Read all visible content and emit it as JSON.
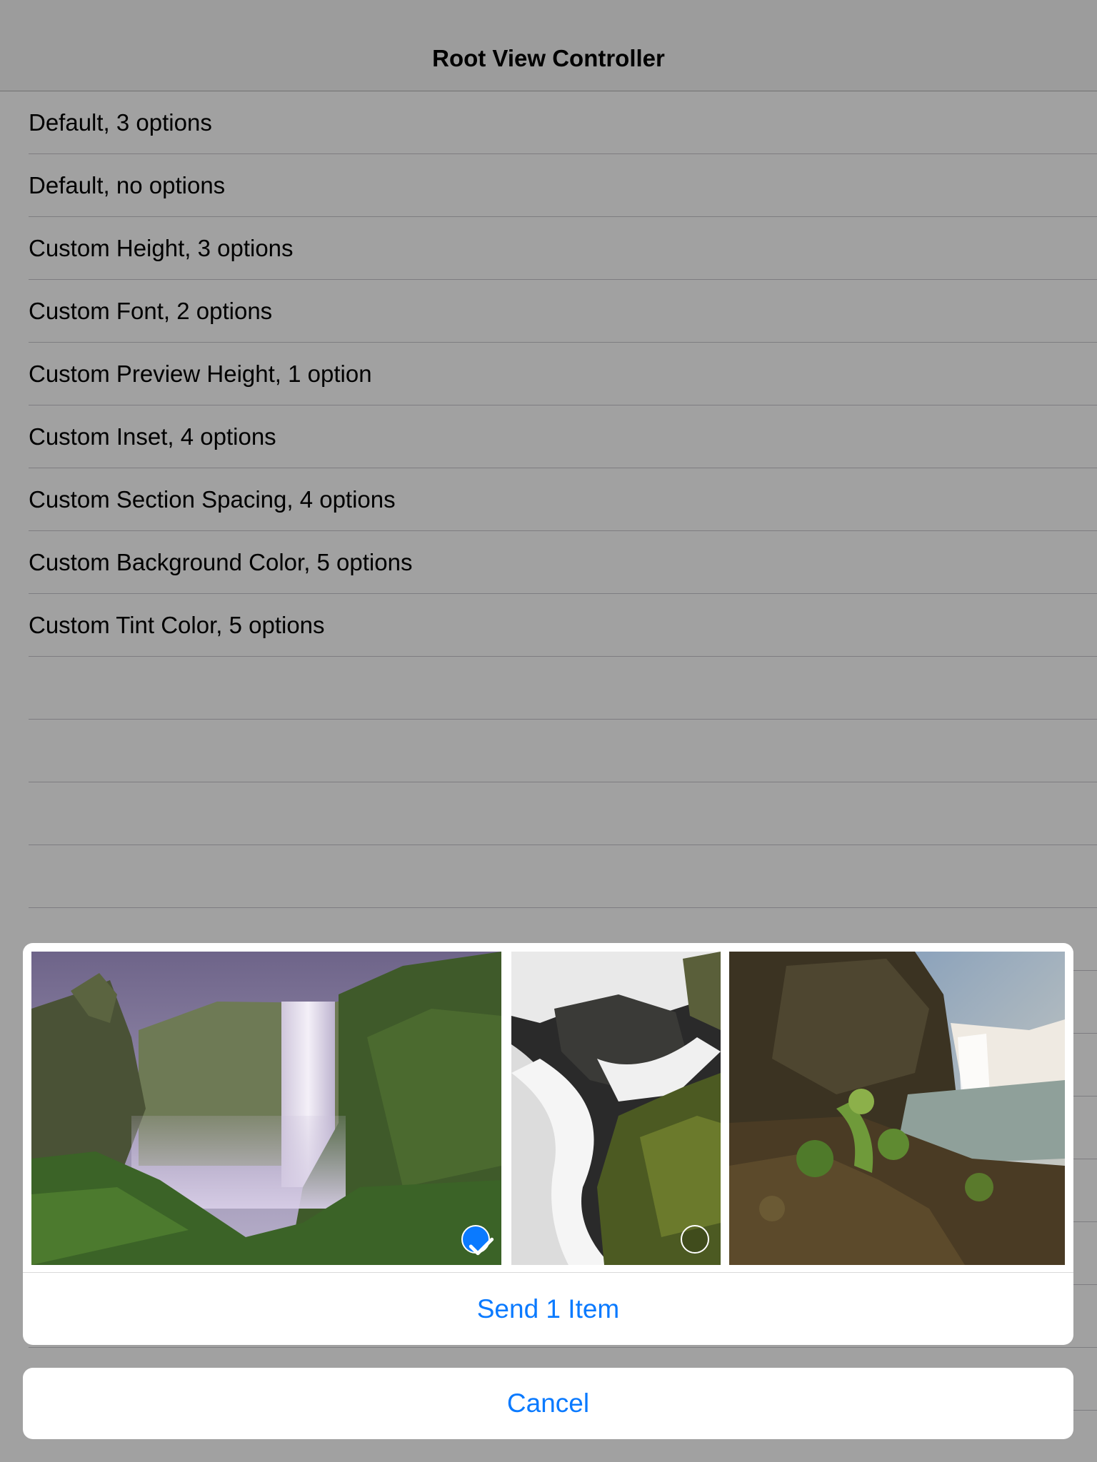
{
  "nav": {
    "title": "Root View Controller"
  },
  "table": {
    "items": [
      {
        "label": "Default, 3 options"
      },
      {
        "label": "Default, no options"
      },
      {
        "label": "Custom Height, 3 options"
      },
      {
        "label": "Custom Font, 2 options"
      },
      {
        "label": "Custom Preview Height, 1 option"
      },
      {
        "label": "Custom Inset, 4 options"
      },
      {
        "label": "Custom Section Spacing, 4 options"
      },
      {
        "label": "Custom Background Color, 5 options"
      },
      {
        "label": "Custom Tint Color, 5 options"
      }
    ]
  },
  "sheet": {
    "photos": [
      {
        "name": "waterfall-cliff-photo",
        "selected": true
      },
      {
        "name": "stream-rocks-photo",
        "selected": false
      },
      {
        "name": "river-waterfall-photo",
        "selected": null
      }
    ],
    "send_label": "Send 1 Item",
    "cancel_label": "Cancel"
  },
  "colors": {
    "tint": "#0a7aff",
    "dim_overlay": "rgba(0,0,0,0.37)"
  }
}
